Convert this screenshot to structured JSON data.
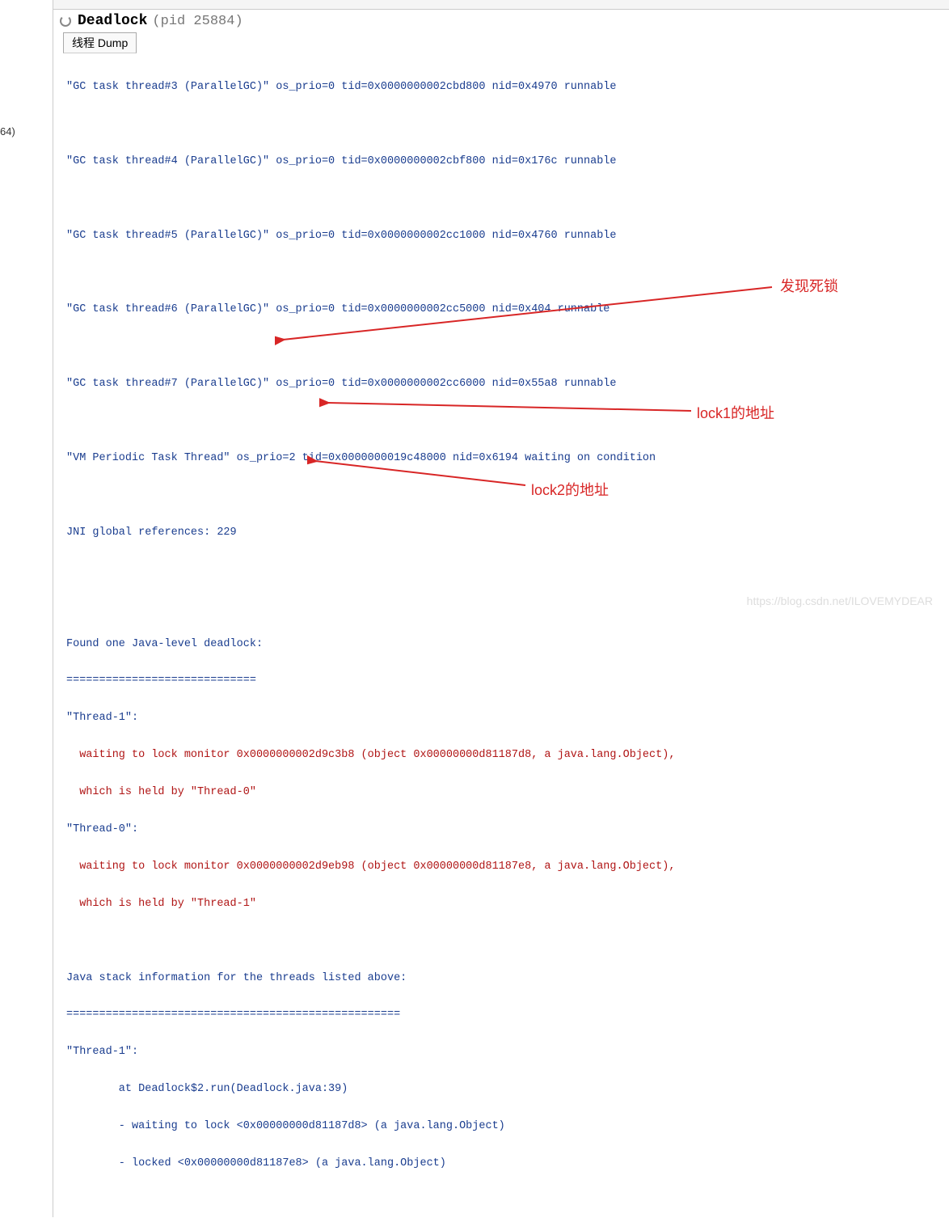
{
  "sidebar": {
    "fragment": "64)"
  },
  "title": {
    "name": "Deadlock",
    "pid": "(pid 25884)"
  },
  "tab": {
    "label": "线程 Dump"
  },
  "dump": {
    "gc3": "\"GC task thread#3 (ParallelGC)\" os_prio=0 tid=0x0000000002cbd800 nid=0x4970 runnable",
    "gc4": "\"GC task thread#4 (ParallelGC)\" os_prio=0 tid=0x0000000002cbf800 nid=0x176c runnable",
    "gc5": "\"GC task thread#5 (ParallelGC)\" os_prio=0 tid=0x0000000002cc1000 nid=0x4760 runnable",
    "gc6": "\"GC task thread#6 (ParallelGC)\" os_prio=0 tid=0x0000000002cc5000 nid=0x404 runnable",
    "gc7": "\"GC task thread#7 (ParallelGC)\" os_prio=0 tid=0x0000000002cc6000 nid=0x55a8 runnable",
    "vm": "\"VM Periodic Task Thread\" os_prio=2 tid=0x0000000019c48000 nid=0x6194 waiting on condition",
    "jni": "JNI global references: 229",
    "found": "Found one Java-level deadlock:",
    "sep1": "=============================",
    "t1": "\"Thread-1\":",
    "t1_wait": "  waiting to lock monitor 0x0000000002d9c3b8 (object 0x00000000d81187d8, a java.lang.Object),",
    "t1_held": "  which is held by \"Thread-0\"",
    "t0": "\"Thread-0\":",
    "t0_wait": "  waiting to lock monitor 0x0000000002d9eb98 (object 0x00000000d81187e8, a java.lang.Object),",
    "t0_held": "  which is held by \"Thread-1\"",
    "stack_hdr": "Java stack information for the threads listed above:",
    "sep2": "===================================================",
    "t1b": "\"Thread-1\":",
    "s_at": "        at Deadlock$2.run(Deadlock.java:39)",
    "s_wait": "        - waiting to lock <0x00000000d81187d8> (a java.lang.Object)",
    "s_lock": "        - locked <0x00000000d81187e8> (a java.lang.Object)"
  },
  "annotations": {
    "a1": "发现死锁",
    "a2": "lock1的地址",
    "a3": "lock2的地址"
  },
  "watermark": "https://blog.csdn.net/ILOVEMYDEAR"
}
